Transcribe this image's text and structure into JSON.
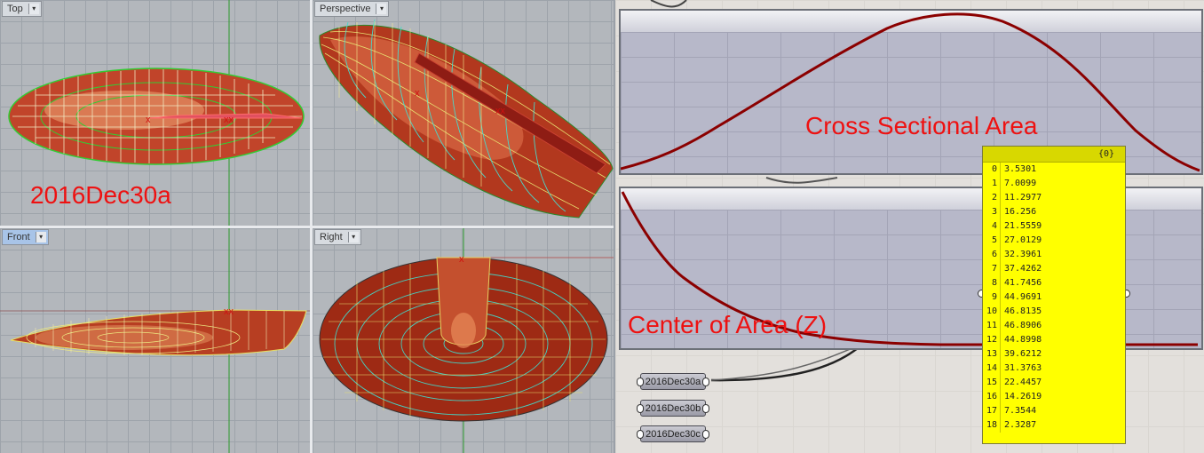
{
  "viewports": {
    "top": {
      "label": "Top"
    },
    "perspective": {
      "label": "Perspective"
    },
    "front": {
      "label": "Front"
    },
    "right": {
      "label": "Right"
    }
  },
  "model_name_overlay": "2016Dec30a",
  "graphs": {
    "area_title": "Cross Sectional Area",
    "center_title": "Center of Area (Z)"
  },
  "params": [
    {
      "label": "2016Dec30a"
    },
    {
      "label": "2016Dec30b"
    },
    {
      "label": "2016Dec30c"
    }
  ],
  "panel": {
    "header": "{0}",
    "rows": [
      {
        "i": "0",
        "v": "3.5301"
      },
      {
        "i": "1",
        "v": "7.0099"
      },
      {
        "i": "2",
        "v": "11.2977"
      },
      {
        "i": "3",
        "v": "16.256"
      },
      {
        "i": "4",
        "v": "21.5559"
      },
      {
        "i": "5",
        "v": "27.0129"
      },
      {
        "i": "6",
        "v": "32.3961"
      },
      {
        "i": "7",
        "v": "37.4262"
      },
      {
        "i": "8",
        "v": "41.7456"
      },
      {
        "i": "9",
        "v": "44.9691"
      },
      {
        "i": "10",
        "v": "46.8135"
      },
      {
        "i": "11",
        "v": "46.8906"
      },
      {
        "i": "12",
        "v": "44.8998"
      },
      {
        "i": "13",
        "v": "39.6212"
      },
      {
        "i": "14",
        "v": "31.3763"
      },
      {
        "i": "15",
        "v": "22.4457"
      },
      {
        "i": "16",
        "v": "14.2619"
      },
      {
        "i": "17",
        "v": "7.3544"
      },
      {
        "i": "18",
        "v": "2.3287"
      }
    ]
  },
  "colors": {
    "curve": "#8b0000",
    "label_red": "#ee1111",
    "panel_yellow": "#ffff00"
  }
}
